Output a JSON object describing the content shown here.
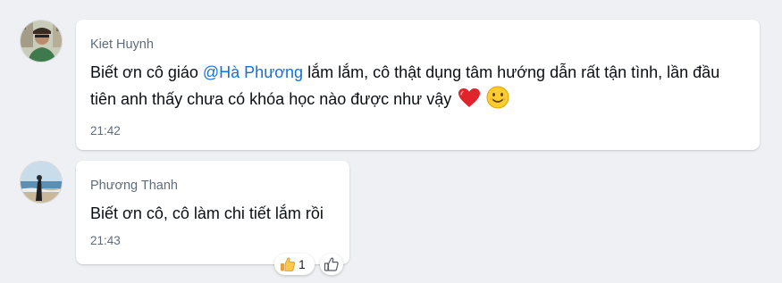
{
  "messages": [
    {
      "sender": "Kiet Huynh",
      "text_before": "Biết ơn cô giáo ",
      "mention": "@Hà Phương",
      "text_after": " lắm lắm, cô thật dụng tâm hướng dẫn rất tận tình, lần đầu tiên anh thấy chưa có khóa học nào được như vậy",
      "emojis": [
        "red-heart",
        "smiling-face"
      ],
      "time": "21:42"
    },
    {
      "sender": "Phương Thanh",
      "text": "Biết ơn cô, cô làm chi tiết lắm rồi",
      "time": "21:43",
      "reaction": {
        "icon": "thumbs-up-emoji",
        "count": "1",
        "add_icon": "thumbs-up-outline-icon"
      }
    }
  ],
  "colors": {
    "background": "#eef0f3",
    "bubble": "#ffffff",
    "mention": "#1570d8",
    "sender": "#5f6b7a",
    "text": "#0b0f14"
  }
}
